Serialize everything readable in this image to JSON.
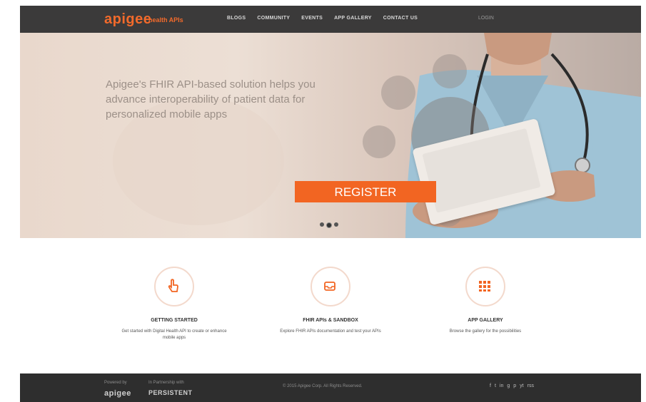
{
  "header": {
    "logo": "apigee",
    "logo_sub": "health APIs",
    "nav": [
      "BLOGS",
      "COMMUNITY",
      "EVENTS",
      "APP GALLERY",
      "CONTACT US"
    ],
    "login": "LOGIN"
  },
  "hero": {
    "headline": "Apigee's FHIR API-based solution helps you advance interoperability of patient data for personalized mobile apps",
    "register_label": "REGISTER"
  },
  "features": [
    {
      "icon": "hand-pointer-icon",
      "title": "GETTING STARTED",
      "description": "Get started with Digital Health API to create or enhance mobile apps"
    },
    {
      "icon": "inbox-icon",
      "title": "FHIR APIs & SANDBOX",
      "description": "Explore FHIR APIs documentation and test your APIs"
    },
    {
      "icon": "grid-icon",
      "title": "APP GALLERY",
      "description": "Browse the gallery for the possibilities"
    }
  ],
  "footer": {
    "powered_by": "Powered by",
    "powered_brand": "apigee",
    "partnership": "In Partnership with",
    "partner_brand": "PERSISTENT",
    "copyright": "© 2015 Apigee Corp. All Rights Reserved.",
    "social": [
      "f",
      "t",
      "in",
      "g",
      "p",
      "yt",
      "rss"
    ]
  },
  "colors": {
    "accent": "#f26522",
    "topbar": "#3b3a3a",
    "footer": "#2e2e2e"
  }
}
